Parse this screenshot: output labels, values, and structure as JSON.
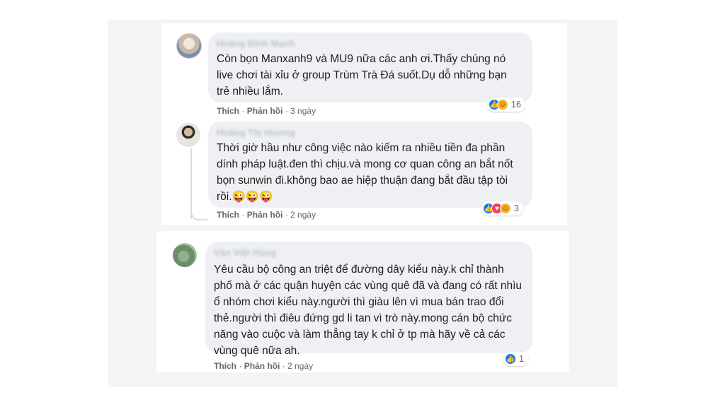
{
  "comments": [
    {
      "author": "Hoàng Đình Mạnh",
      "text": "Còn bọn Manxanh9 và MU9 nữa các anh ơi.Thấy chúng nó live chơi tài xỉu ở group Trùm Trà Đá suốt.Dụ dỗ những bạn trẻ nhiều lắm.",
      "like_label": "Thích",
      "reply_label": "Phản hồi",
      "separator": "·",
      "time": "3 ngày",
      "reactions": [
        "like-icon",
        "haha-icon"
      ],
      "reaction_count": "16"
    },
    {
      "author": "Hoàng Thị Hương",
      "text": "Thời giờ hầu như công việc nào kiếm ra nhiều tiền đa phần dính pháp luật.đen thì chịu.và mong cơ quan công an bắt nốt bọn sunwin đi.không bao ae hiệp thuận đang bắt đầu tập tòi rồi.😜😜😜",
      "like_label": "Thích",
      "reply_label": "Phản hồi",
      "separator": "·",
      "time": "2 ngày",
      "reactions": [
        "like-icon",
        "love-icon",
        "haha-icon"
      ],
      "reaction_count": "3"
    },
    {
      "author": "Văn Việt Hùng",
      "text": "Yêu cầu bộ công an triệt để đường dây kiểu này.k chỉ thành phố mà ở các quận huyện các vùng quê đã và đang có rất nhìu ổ nhóm chơi kiểu này.người thì giàu lên vì mua bán trao đổi thẻ.người thì điêu đứng gd li tan vì trò này.mong cán bộ chức năng vào cuộc và làm thẳng tay k chỉ ở tp mà hãy về cả các vùng quê nữa ah.",
      "like_label": "Thích",
      "reply_label": "Phản hồi",
      "separator": "·",
      "time": "2 ngày",
      "reactions": [
        "like-icon"
      ],
      "reaction_count": "1"
    }
  ],
  "colors": {
    "like": "#1877f2",
    "haha": "#f7b125",
    "love": "#f33e58",
    "bubble": "#eef0f3",
    "meta_text": "#65676b"
  }
}
